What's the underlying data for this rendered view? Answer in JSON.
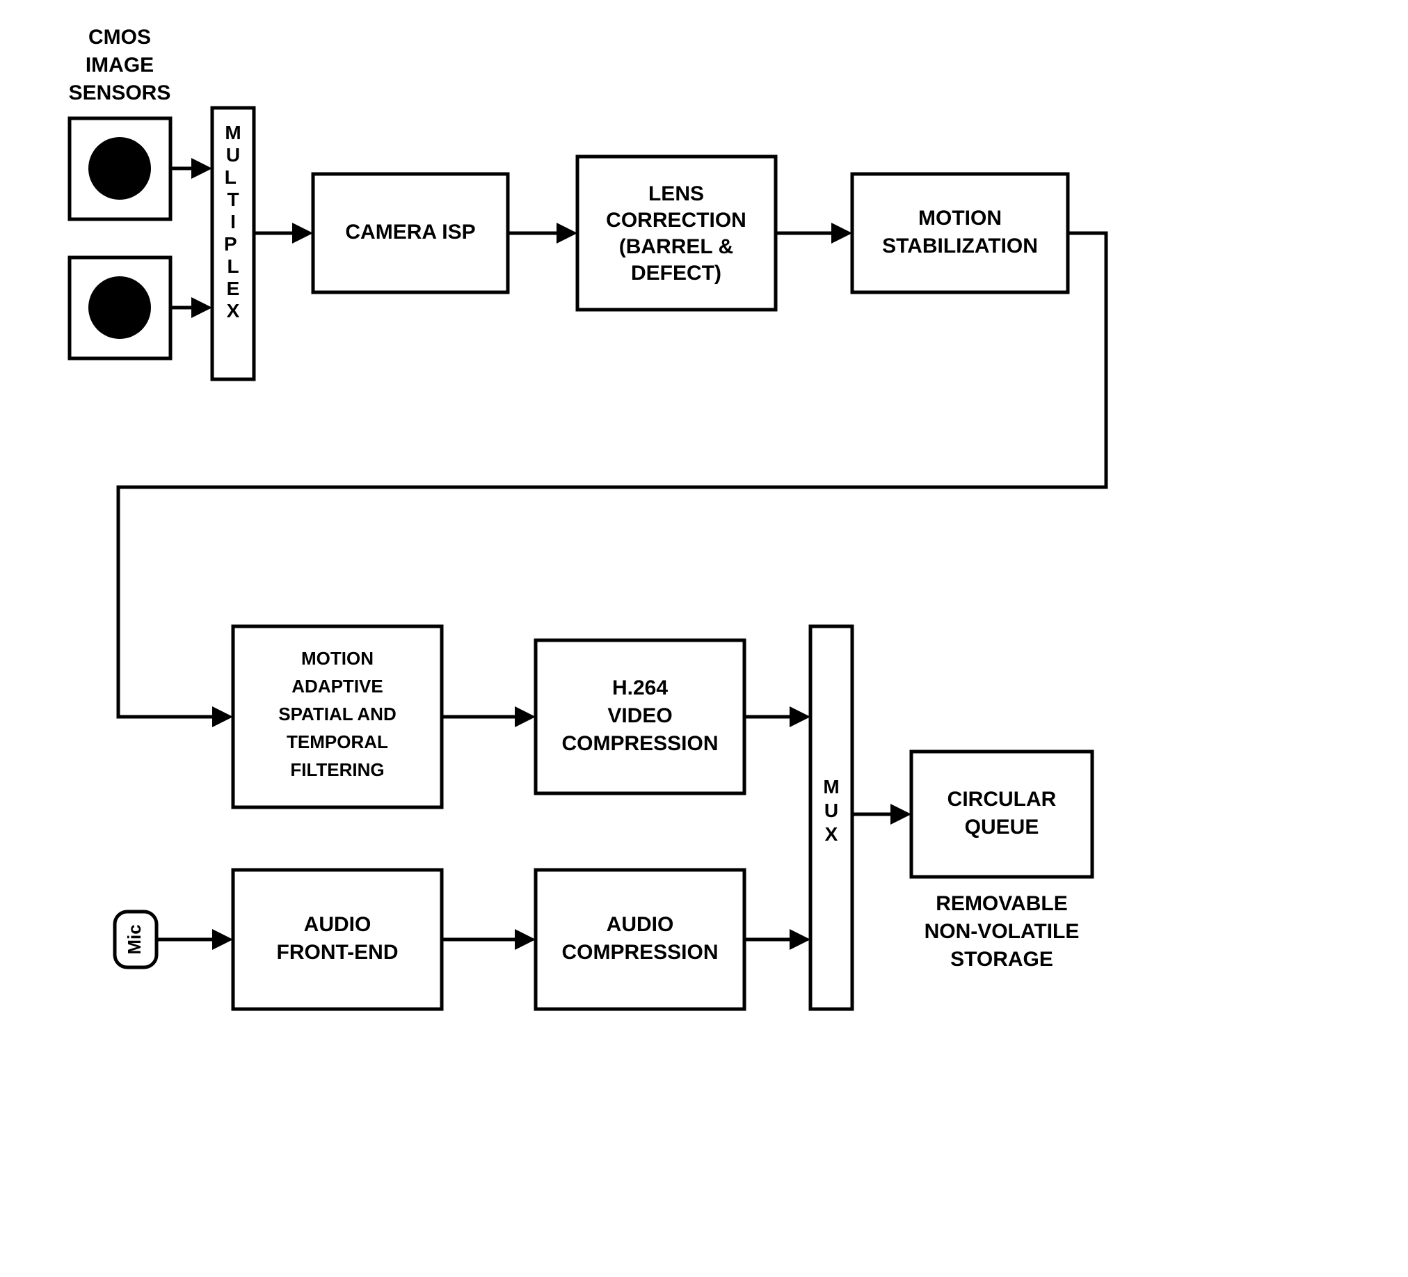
{
  "title_cmos": "CMOS",
  "title_image": "IMAGE",
  "title_sensors": "SENSORS",
  "multiplex": "MULTIPLEX",
  "camera_isp": "CAMERA ISP",
  "lens_l1": "LENS",
  "lens_l2": "CORRECTION",
  "lens_l3": "(BARREL &",
  "lens_l4": "DEFECT)",
  "motion_stab_l1": "MOTION",
  "motion_stab_l2": "STABILIZATION",
  "maf_l1": "MOTION",
  "maf_l2": "ADAPTIVE",
  "maf_l3": "SPATIAL AND",
  "maf_l4": "TEMPORAL",
  "maf_l5": "FILTERING",
  "h264_l1": "H.264",
  "h264_l2": "VIDEO",
  "h264_l3": "COMPRESSION",
  "mux": "MUX",
  "audio_fe_l1": "AUDIO",
  "audio_fe_l2": "FRONT-END",
  "audio_comp_l1": "AUDIO",
  "audio_comp_l2": "COMPRESSION",
  "circ_q_l1": "CIRCULAR",
  "circ_q_l2": "QUEUE",
  "storage_l1": "REMOVABLE",
  "storage_l2": "NON-VOLATILE",
  "storage_l3": "STORAGE",
  "mic": "Mic"
}
